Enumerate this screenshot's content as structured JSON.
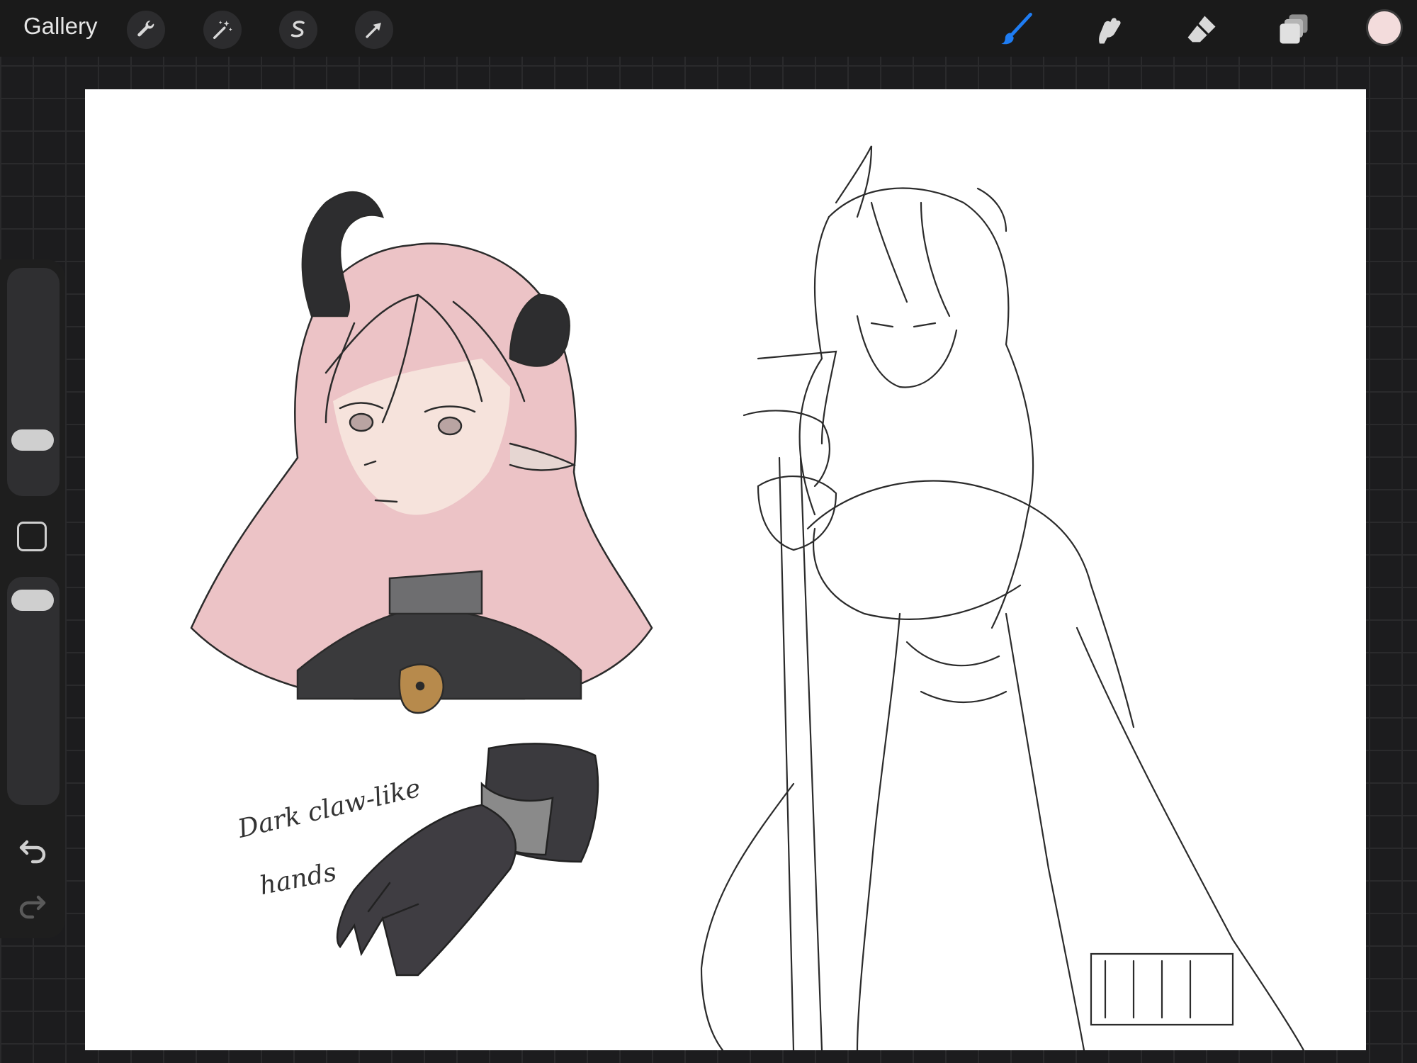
{
  "topbar": {
    "gallery_label": "Gallery",
    "left_tools": [
      {
        "name": "actions",
        "icon": "wrench-icon"
      },
      {
        "name": "adjustments",
        "icon": "magic-wand-icon"
      },
      {
        "name": "selection",
        "icon": "selection-s-icon"
      },
      {
        "name": "transform",
        "icon": "arrow-cursor-icon"
      }
    ],
    "right_tools": [
      {
        "name": "brush",
        "icon": "brush-icon",
        "active": true,
        "color": "#1e7cf2"
      },
      {
        "name": "smudge",
        "icon": "smudge-finger-icon"
      },
      {
        "name": "eraser",
        "icon": "eraser-icon"
      },
      {
        "name": "layers",
        "icon": "layers-icon"
      }
    ],
    "current_color": "#f3dcdc"
  },
  "sidebar": {
    "controls": [
      "brush-size-slider",
      "modify-button",
      "opacity-slider",
      "undo-button",
      "redo-button"
    ]
  },
  "canvas": {
    "annotation": {
      "line1": "Dark claw-like",
      "line2": "hands"
    },
    "sketches": [
      "character-head-colored-sketch",
      "claw-hand-sketch",
      "full-body-line-sketch"
    ]
  }
}
